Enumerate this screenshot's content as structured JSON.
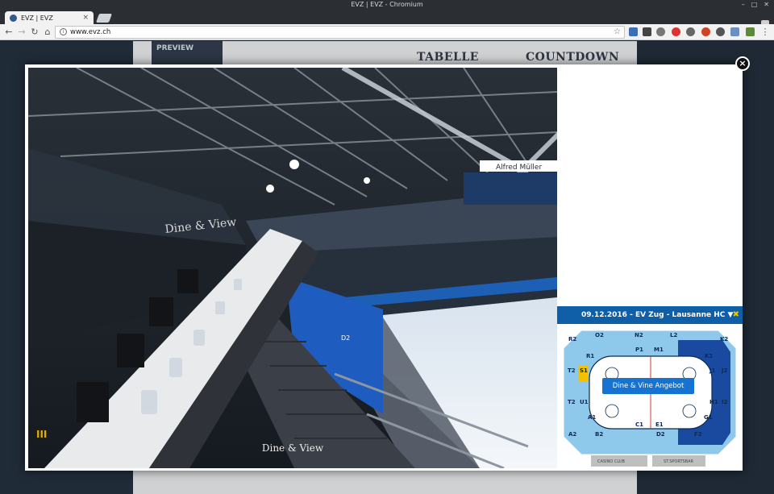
{
  "window": {
    "title": "EVZ | EVZ - Chromium"
  },
  "tab": {
    "title": "EVZ | EVZ",
    "close": "×"
  },
  "address": {
    "url": "www.evz.ch"
  },
  "page": {
    "preview_label": "PREVIEW",
    "header_left": "TABELLE",
    "header_right": "COUNTDOWN"
  },
  "lightbox": {
    "caption": "Dine & View",
    "wall_text": "Dine & View",
    "close": "×",
    "menu_glyph": "III",
    "ad_text": "Alfred Müller"
  },
  "seatmap": {
    "title": "09.12.2016 - EV Zug - Lausanne HC ▼",
    "close_glyph": "✖",
    "button_label": "Dine & Vine Angebot",
    "sections": [
      "R2",
      "O2",
      "N2",
      "L2",
      "K2",
      "R1",
      "P1",
      "M1",
      "K1",
      "S1",
      "J1",
      "T2",
      "J2",
      "U1",
      "H1",
      "T2",
      "I2",
      "A1",
      "G1",
      "A2",
      "B2",
      "C1",
      "E1",
      "F2",
      "D2"
    ],
    "bottom_labels": [
      "CASINO CLUB",
      "ST.SPORTSBAR"
    ]
  },
  "colors": {
    "header_blue": "#0f5fa8",
    "section_light": "#8ec8ea",
    "section_dark": "#1a4aa0",
    "accent_yellow": "#f2c200"
  }
}
